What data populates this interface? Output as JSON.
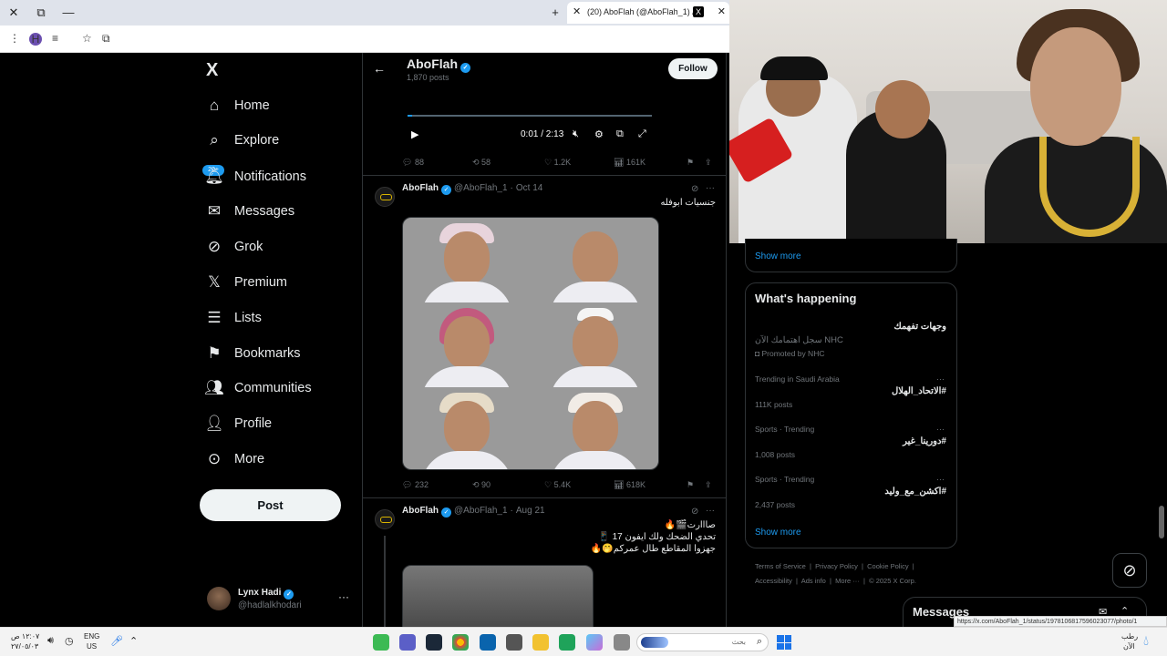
{
  "browser": {
    "tab_title": "(20) AboFlah (@AboFlah_1) / X",
    "tab_logo": "X",
    "controls": [
      "close-icon",
      "restore-icon",
      "minimize-icon",
      "new-tab-icon"
    ]
  },
  "nav": {
    "logo": "X",
    "items": [
      {
        "label": "Home",
        "icon": "home-icon"
      },
      {
        "label": "Explore",
        "icon": "search-icon"
      },
      {
        "label": "Notifications",
        "icon": "bell-icon",
        "badge": "20+"
      },
      {
        "label": "Messages",
        "icon": "mail-icon"
      },
      {
        "label": "Grok",
        "icon": "grok-icon"
      },
      {
        "label": "Premium",
        "icon": "x-icon"
      },
      {
        "label": "Lists",
        "icon": "list-icon"
      },
      {
        "label": "Bookmarks",
        "icon": "bookmark-icon"
      },
      {
        "label": "Communities",
        "icon": "people-icon"
      },
      {
        "label": "Profile",
        "icon": "person-icon"
      },
      {
        "label": "More",
        "icon": "more-circle-icon"
      }
    ],
    "post_label": "Post",
    "account": {
      "name": "Lynx Hadi",
      "handle": "@hadlalkhodari"
    }
  },
  "header": {
    "title": "AboFlah",
    "post_count": "1,870 posts",
    "follow_label": "Follow"
  },
  "video_player": {
    "time": "0:01 / 2:13",
    "progress": 0.008
  },
  "tweets": [
    {
      "stats": {
        "replies": "88",
        "reposts": "58",
        "likes": "1.2K",
        "views": "161K"
      }
    },
    {
      "name": "AboFlah",
      "handle": "@AboFlah_1",
      "date": "Oct 14",
      "text": "جنسيات ابوفله",
      "stats": {
        "replies": "232",
        "reposts": "90",
        "likes": "5.4K",
        "views": "618K"
      }
    },
    {
      "name": "AboFlah",
      "handle": "@AboFlah_1",
      "date": "Aug 21",
      "lines": [
        "صااارت🎬🔥",
        "تحدي الضحك ولك ايفون 17 📱",
        "جهزوا المقاطع طال عمركم🤭🔥"
      ]
    }
  ],
  "sidebar": {
    "show_more_top": "Show more",
    "whats_happening": "What's happening",
    "promo": {
      "title": "وجهات تفهمك",
      "subtitle": "سجل اهتمامك الآن NHC",
      "promoted": "Promoted by NHC"
    },
    "trends": [
      {
        "context": "Trending in Saudi Arabia",
        "tag": "#الاتحاد_الهلال",
        "posts": "111K posts"
      },
      {
        "context": "Sports · Trending",
        "tag": "#دورينا_غير",
        "posts": "1,008 posts"
      },
      {
        "context": "Sports · Trending",
        "tag": "#اكشن_مع_وليد",
        "posts": "2,437 posts"
      }
    ],
    "show_more_bottom": "Show more",
    "footer": [
      "Terms of Service",
      "Privacy Policy",
      "Cookie Policy",
      "Accessibility",
      "Ads info",
      "More ···",
      "© 2025 X Corp."
    ],
    "messages_title": "Messages"
  },
  "status_url": "https://x.com/AboFlah_1/status/1978106817596023077/photo/1",
  "taskbar": {
    "time": "١٢:٠٧ ص",
    "date": "٢٧/٠٥/٠٣",
    "lang_top": "ENG",
    "lang_bottom": "US",
    "search_placeholder": "بحث",
    "weather_top": "رطب",
    "weather_bottom": "الآن"
  }
}
